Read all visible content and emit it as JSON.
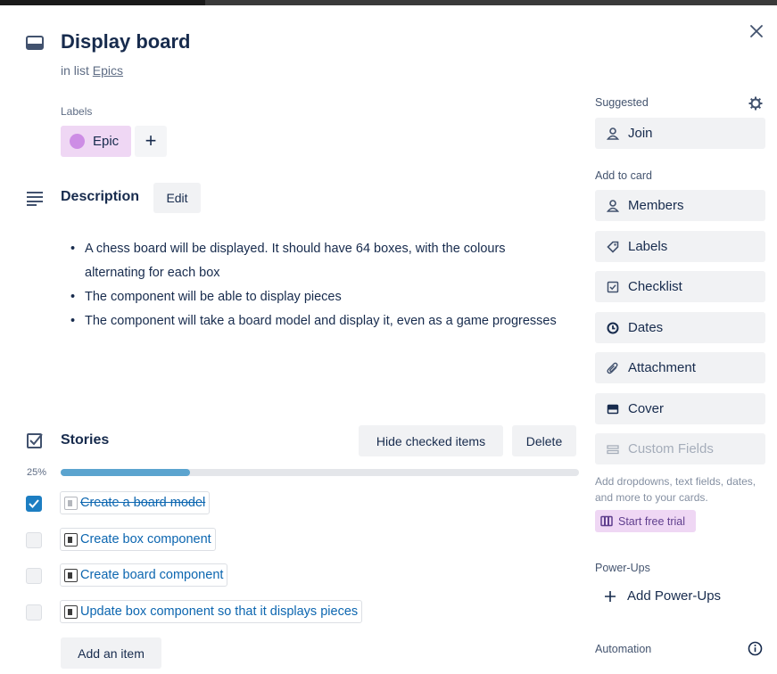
{
  "card": {
    "title": "Display board",
    "in_list_prefix": "in list",
    "list_name": "Epics",
    "close_icon": "close-icon"
  },
  "labels": {
    "heading": "Labels",
    "items": [
      {
        "name": "Epic",
        "color": "#cd8de5"
      }
    ],
    "add_symbol": "+"
  },
  "description": {
    "heading": "Description",
    "edit_label": "Edit",
    "bullets": [
      "A chess board will be displayed. It should have 64 boxes, with the colours alternating for each box",
      "The component will be able to display pieces",
      "The component will take a board model and display it, even as a game progresses"
    ]
  },
  "checklist": {
    "title": "Stories",
    "hide_checked_label": "Hide checked items",
    "delete_label": "Delete",
    "progress_text": "25%",
    "progress_value": 0.25,
    "items": [
      {
        "text": "Create a board model",
        "checked": true
      },
      {
        "text": "Create box component",
        "checked": false
      },
      {
        "text": "Create board component",
        "checked": false
      },
      {
        "text": "Update box component so that it displays pieces",
        "checked": false
      }
    ],
    "add_item_label": "Add an item"
  },
  "sidebar": {
    "suggested_heading": "Suggested",
    "join_label": "Join",
    "add_to_card_heading": "Add to card",
    "members_label": "Members",
    "labels_label": "Labels",
    "checklist_label": "Checklist",
    "dates_label": "Dates",
    "attachment_label": "Attachment",
    "cover_label": "Cover",
    "custom_fields_label": "Custom Fields",
    "custom_fields_note": "Add dropdowns, text fields, dates, and more to your cards.",
    "start_trial_label": "Start free trial",
    "powerups_heading": "Power-Ups",
    "add_powerups_label": "Add Power-Ups",
    "automation_heading": "Automation"
  },
  "colors": {
    "accent_blue": "#1d7ec2",
    "progress_blue": "#5ba4cf",
    "label_purple": "#cd8de5",
    "label_bg": "#efd7f4"
  }
}
